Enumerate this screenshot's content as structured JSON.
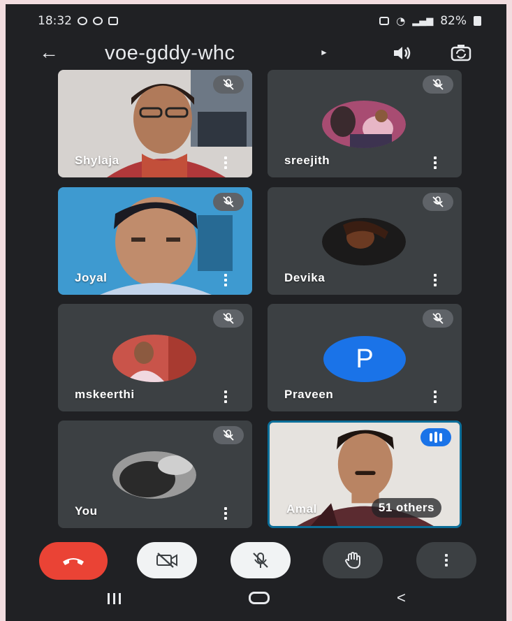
{
  "status": {
    "time": "18:32",
    "signal_text": "ᯤ",
    "battery": "82%"
  },
  "meeting": {
    "code": "voe-gddy-whc"
  },
  "participants": [
    {
      "name": "Shylaja",
      "muted": true,
      "view": "video"
    },
    {
      "name": "sreejith",
      "muted": true,
      "view": "avatar-photo"
    },
    {
      "name": "Joyal",
      "muted": true,
      "view": "video"
    },
    {
      "name": "Devika",
      "muted": true,
      "view": "avatar-photo"
    },
    {
      "name": "mskeerthi",
      "muted": true,
      "view": "avatar-photo"
    },
    {
      "name": "Praveen",
      "muted": true,
      "view": "avatar-letter",
      "initial": "P"
    },
    {
      "name": "You",
      "muted": true,
      "view": "avatar-photo"
    },
    {
      "name": "Amal",
      "muted": false,
      "speaking": true,
      "view": "video"
    }
  ],
  "others_label": "51 others",
  "colors": {
    "background": "#202124",
    "tile": "#3c4043",
    "hangup": "#ea4335",
    "accent": "#1a73e8"
  },
  "icons": {
    "back": "arrow-left-icon",
    "speaker": "speaker-icon",
    "flip_camera": "flip-camera-icon",
    "hangup": "phone-hangup-icon",
    "camera_off": "camera-off-icon",
    "mic_off": "mic-off-icon",
    "raise_hand": "hand-icon",
    "more": "more-vert-icon"
  }
}
